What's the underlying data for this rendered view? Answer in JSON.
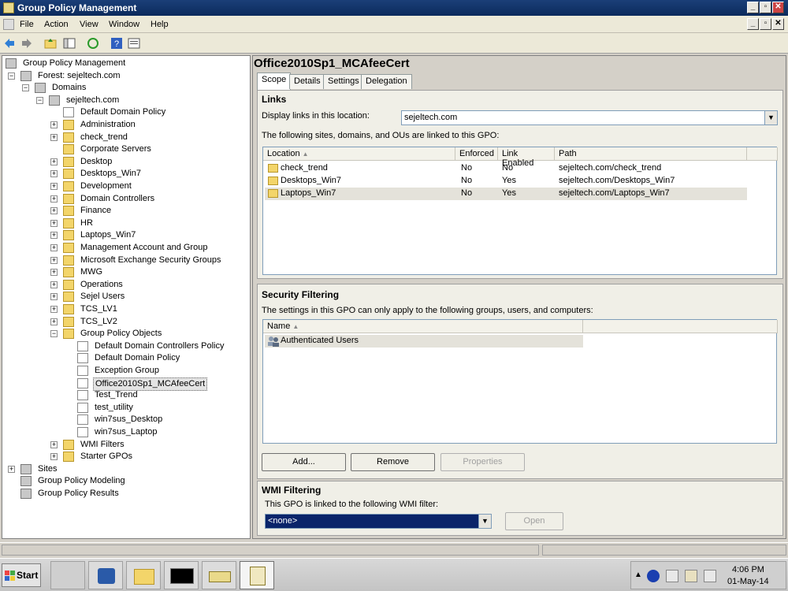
{
  "window": {
    "title": "Group Policy Management",
    "min": "_",
    "max": "▫",
    "close": "✕"
  },
  "menu": [
    "File",
    "Action",
    "View",
    "Window",
    "Help"
  ],
  "tree": [
    {
      "label": "Group Policy Management",
      "level": 0,
      "icon": "gpm-icon"
    },
    {
      "label": "Forest: sejeltech.com",
      "level": 1,
      "icon": "forest-icon",
      "exp": "−"
    },
    {
      "label": "Domains",
      "level": 2,
      "icon": "domains-icon",
      "exp": "−"
    },
    {
      "label": "sejeltech.com",
      "level": 3,
      "icon": "domain-icon",
      "exp": "−"
    },
    {
      "label": "Default Domain Policy",
      "level": 4,
      "icon": "gpo-link-icon"
    },
    {
      "label": "Administration",
      "level": 4,
      "icon": "ou-folder-icon",
      "exp": "+"
    },
    {
      "label": "check_trend",
      "level": 4,
      "icon": "ou-folder-icon",
      "exp": "+"
    },
    {
      "label": "Corporate Servers",
      "level": 4,
      "icon": "ou-folder-icon"
    },
    {
      "label": "Desktop",
      "level": 4,
      "icon": "ou-folder-icon",
      "exp": "+"
    },
    {
      "label": "Desktops_Win7",
      "level": 4,
      "icon": "ou-folder-icon",
      "exp": "+"
    },
    {
      "label": "Development",
      "level": 4,
      "icon": "ou-folder-icon",
      "exp": "+"
    },
    {
      "label": "Domain Controllers",
      "level": 4,
      "icon": "ou-folder-icon",
      "exp": "+"
    },
    {
      "label": "Finance",
      "level": 4,
      "icon": "ou-folder-icon",
      "exp": "+"
    },
    {
      "label": "HR",
      "level": 4,
      "icon": "ou-folder-icon",
      "exp": "+"
    },
    {
      "label": "Laptops_Win7",
      "level": 4,
      "icon": "ou-folder-icon",
      "exp": "+"
    },
    {
      "label": "Management Account and Group",
      "level": 4,
      "icon": "ou-folder-icon",
      "exp": "+"
    },
    {
      "label": "Microsoft Exchange Security Groups",
      "level": 4,
      "icon": "ou-folder-icon",
      "exp": "+"
    },
    {
      "label": "MWG",
      "level": 4,
      "icon": "ou-folder-icon",
      "exp": "+"
    },
    {
      "label": "Operations",
      "level": 4,
      "icon": "ou-folder-icon",
      "exp": "+"
    },
    {
      "label": "Sejel Users",
      "level": 4,
      "icon": "ou-folder-icon",
      "exp": "+"
    },
    {
      "label": "TCS_LV1",
      "level": 4,
      "icon": "ou-folder-icon",
      "exp": "+"
    },
    {
      "label": "TCS_LV2",
      "level": 4,
      "icon": "ou-folder-icon",
      "exp": "+"
    },
    {
      "label": "Group Policy Objects",
      "level": 4,
      "icon": "gpo-folder-icon",
      "exp": "−"
    },
    {
      "label": "Default Domain Controllers Policy",
      "level": 5,
      "icon": "gpo-icon"
    },
    {
      "label": "Default Domain Policy",
      "level": 5,
      "icon": "gpo-icon"
    },
    {
      "label": "Exception Group",
      "level": 5,
      "icon": "gpo-icon"
    },
    {
      "label": "Office2010Sp1_MCAfeeCert",
      "level": 5,
      "icon": "gpo-icon",
      "selected": true
    },
    {
      "label": "Test_Trend",
      "level": 5,
      "icon": "gpo-icon"
    },
    {
      "label": "test_utility",
      "level": 5,
      "icon": "gpo-icon"
    },
    {
      "label": "win7sus_Desktop",
      "level": 5,
      "icon": "gpo-icon"
    },
    {
      "label": "win7sus_Laptop",
      "level": 5,
      "icon": "gpo-icon"
    },
    {
      "label": "WMI Filters",
      "level": 4,
      "icon": "wmi-folder-icon",
      "exp": "+"
    },
    {
      "label": "Starter GPOs",
      "level": 4,
      "icon": "starter-folder-icon",
      "exp": "+"
    },
    {
      "label": "Sites",
      "level": 1,
      "icon": "sites-icon",
      "exp": "+"
    },
    {
      "label": "Group Policy Modeling",
      "level": 1,
      "icon": "modeling-icon"
    },
    {
      "label": "Group Policy Results",
      "level": 1,
      "icon": "results-icon"
    }
  ],
  "main": {
    "title": "Office2010Sp1_MCAfeeCert",
    "tabs": [
      "Scope",
      "Details",
      "Settings",
      "Delegation"
    ],
    "links": {
      "heading": "Links",
      "display_label": "Display links in this location:",
      "location_value": "sejeltech.com",
      "desc": "The following sites, domains, and OUs are linked to this GPO:",
      "columns": [
        "Location",
        "Enforced",
        "Link Enabled",
        "Path"
      ],
      "rows": [
        [
          "check_trend",
          "No",
          "No",
          "sejeltech.com/check_trend"
        ],
        [
          "Desktops_Win7",
          "No",
          "Yes",
          "sejeltech.com/Desktops_Win7"
        ],
        [
          "Laptops_Win7",
          "No",
          "Yes",
          "sejeltech.com/Laptops_Win7"
        ]
      ]
    },
    "security": {
      "heading": "Security Filtering",
      "desc": "The settings in this GPO can only apply to the following groups, users, and computers:",
      "columns": [
        "Name"
      ],
      "rows": [
        "Authenticated Users"
      ],
      "buttons": {
        "add": "Add...",
        "remove": "Remove",
        "properties": "Properties"
      }
    },
    "wmi": {
      "heading": "WMI Filtering",
      "desc": "This GPO is linked to the following WMI filter:",
      "value": "<none>",
      "open": "Open"
    }
  },
  "taskbar": {
    "start": "Start",
    "time": "4:06 PM",
    "date": "01-May-14"
  }
}
